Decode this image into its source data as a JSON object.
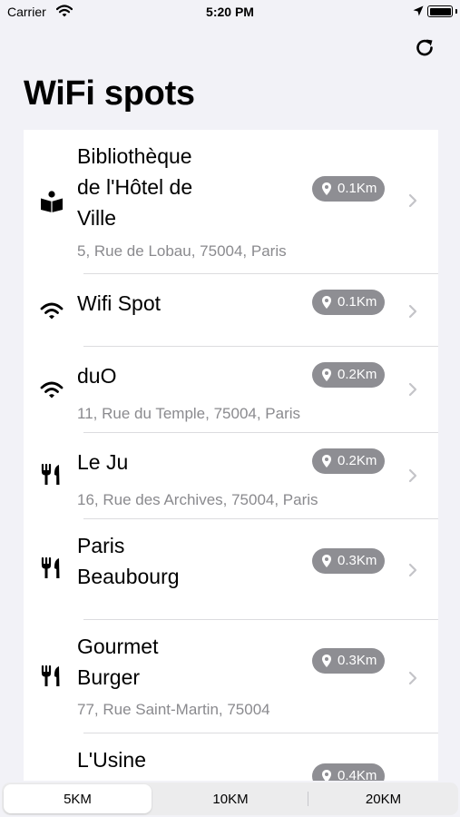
{
  "status": {
    "carrier": "Carrier",
    "time": "5:20 PM"
  },
  "header": {
    "title": "WiFi spots",
    "refresh_icon": "refresh-icon"
  },
  "spots": [
    {
      "icon": "library-icon",
      "name": "Bibliothèque\nde l'Hôtel de\nVille",
      "address": "5, Rue de Lobau, 75004, Paris",
      "distance": "0.1Km"
    },
    {
      "icon": "wifi-icon",
      "name": "Wifi Spot",
      "address": "",
      "distance": "0.1Km"
    },
    {
      "icon": "wifi-icon",
      "name": "duO",
      "address": "11, Rue du Temple, 75004, Paris",
      "distance": "0.2Km"
    },
    {
      "icon": "restaurant-icon",
      "name": "Le Ju",
      "address": "16, Rue des Archives, 75004, Paris",
      "distance": "0.2Km"
    },
    {
      "icon": "restaurant-icon",
      "name": "Paris\nBeaubourg",
      "address": "",
      "distance": "0.3Km"
    },
    {
      "icon": "restaurant-icon",
      "name": "Gourmet\nBurger",
      "address": "77, Rue Saint-Martin, 75004",
      "distance": "0.3Km"
    },
    {
      "icon": "restaurant-icon",
      "name": "L'Usine",
      "address": "",
      "distance": "0.4Km"
    }
  ],
  "segments": {
    "options": [
      "5KM",
      "10KM",
      "20KM"
    ],
    "selected": "5KM"
  }
}
